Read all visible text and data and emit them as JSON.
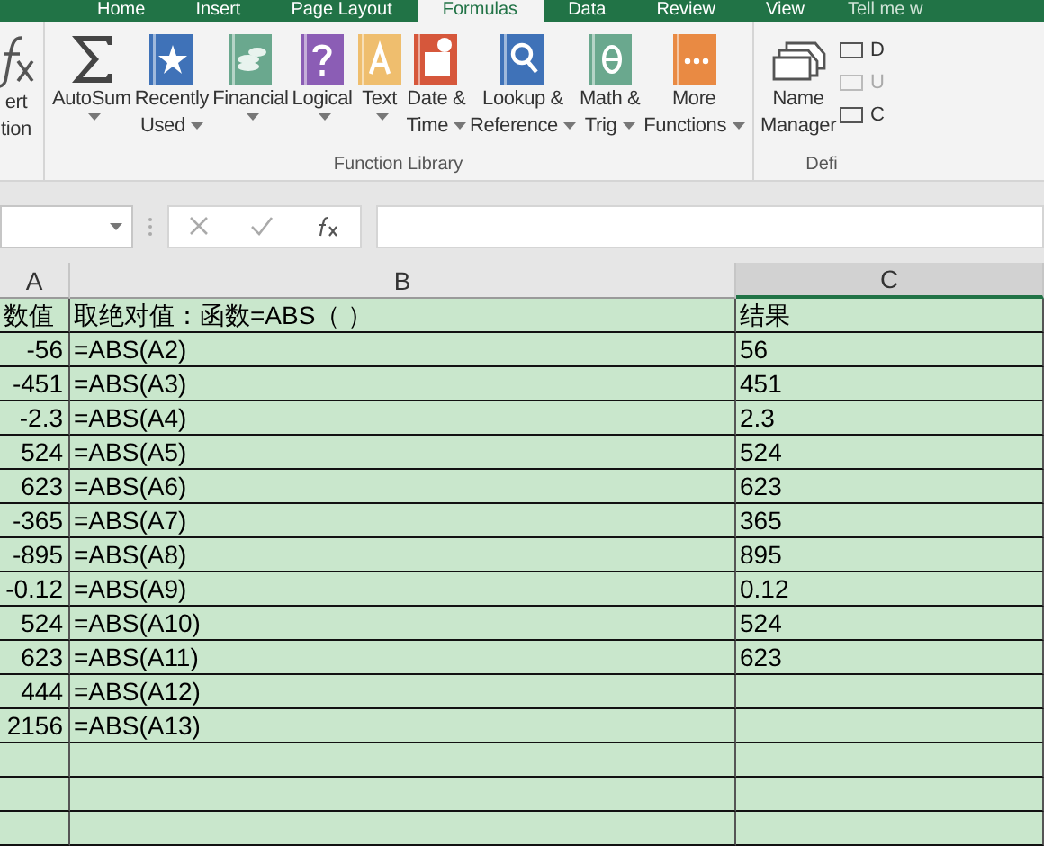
{
  "tabs": [
    {
      "label": "Home",
      "selected": false
    },
    {
      "label": "Insert",
      "selected": false
    },
    {
      "label": "Page Layout",
      "selected": false
    },
    {
      "label": "Formulas",
      "selected": true
    },
    {
      "label": "Data",
      "selected": false
    },
    {
      "label": "Review",
      "selected": false
    },
    {
      "label": "View",
      "selected": false
    }
  ],
  "tell_me": "Tell me w",
  "ribbon": {
    "groups": [
      {
        "buttons": [
          {
            "kind": "fx",
            "lines": [
              "ert",
              "tion"
            ],
            "dropdown": false
          }
        ]
      },
      {
        "label": "Function Library",
        "buttons": [
          {
            "kind": "sigma",
            "lines": [
              "AutoSum"
            ],
            "dropdown": true
          },
          {
            "kind": "star",
            "lines": [
              "Recently",
              "Used"
            ],
            "dropdown": true
          },
          {
            "kind": "coins",
            "lines": [
              "Financial"
            ],
            "dropdown": true
          },
          {
            "kind": "question",
            "lines": [
              "Logical"
            ],
            "dropdown": true
          },
          {
            "kind": "letter",
            "lines": [
              "Text"
            ],
            "dropdown": true
          },
          {
            "kind": "calendar",
            "lines": [
              "Date &",
              "Time"
            ],
            "dropdown": true
          },
          {
            "kind": "magnifier",
            "lines": [
              "Lookup &",
              "Reference"
            ],
            "dropdown": true
          },
          {
            "kind": "theta",
            "lines": [
              "Math &",
              "Trig"
            ],
            "dropdown": true
          },
          {
            "kind": "dots",
            "lines": [
              "More",
              "Functions"
            ],
            "dropdown": true
          }
        ]
      },
      {
        "label": "Defi",
        "buttons": [
          {
            "kind": "tags",
            "lines": [
              "Name",
              "Manager"
            ],
            "dropdown": false
          }
        ],
        "small": [
          {
            "label": "D",
            "disabled": false
          },
          {
            "label": "U",
            "disabled": true
          },
          {
            "label": "C",
            "disabled": false
          }
        ]
      }
    ]
  },
  "columns": [
    {
      "label": "A",
      "selected": false
    },
    {
      "label": "B",
      "selected": false
    },
    {
      "label": "C",
      "selected": true
    }
  ],
  "rows": [
    [
      "数值",
      "取绝对值：函数=ABS（ ）",
      "结果"
    ],
    [
      "-56",
      "=ABS(A2)",
      "56"
    ],
    [
      "-451",
      "=ABS(A3)",
      "451"
    ],
    [
      "-2.3",
      "=ABS(A4)",
      "2.3"
    ],
    [
      "524",
      "=ABS(A5)",
      "524"
    ],
    [
      "623",
      "=ABS(A6)",
      "623"
    ],
    [
      "-365",
      "=ABS(A7)",
      "365"
    ],
    [
      "-895",
      "=ABS(A8)",
      "895"
    ],
    [
      "-0.12",
      "=ABS(A9)",
      "0.12"
    ],
    [
      "524",
      "=ABS(A10)",
      "524"
    ],
    [
      "623",
      "=ABS(A11)",
      "623"
    ],
    [
      "444",
      "=ABS(A12)",
      ""
    ],
    [
      "2156",
      "=ABS(A13)",
      ""
    ],
    [
      "",
      "",
      ""
    ],
    [
      "",
      "",
      ""
    ],
    [
      "",
      "",
      ""
    ]
  ]
}
